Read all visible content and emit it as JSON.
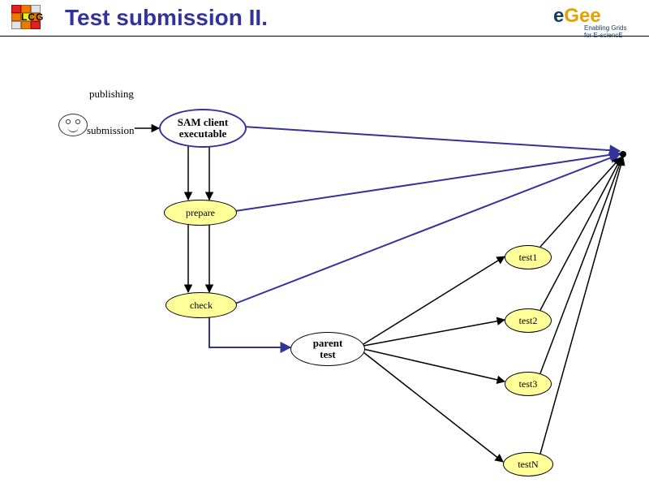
{
  "header": {
    "title": "Test submission II.",
    "lcg_text": "LCG",
    "egee_text_e": "e",
    "egee_text_gee": "Gee",
    "egee_sub": "Enabling Grids for E-sciencE"
  },
  "diagram": {
    "publishing_label": "publishing",
    "submission_label": "submission",
    "sam_client": "SAM client\nexecutable",
    "prepare": "prepare",
    "check": "check",
    "parent_test": "parent\ntest",
    "test1": "test1",
    "test2": "test2",
    "test3": "test3",
    "testN": "testN"
  }
}
